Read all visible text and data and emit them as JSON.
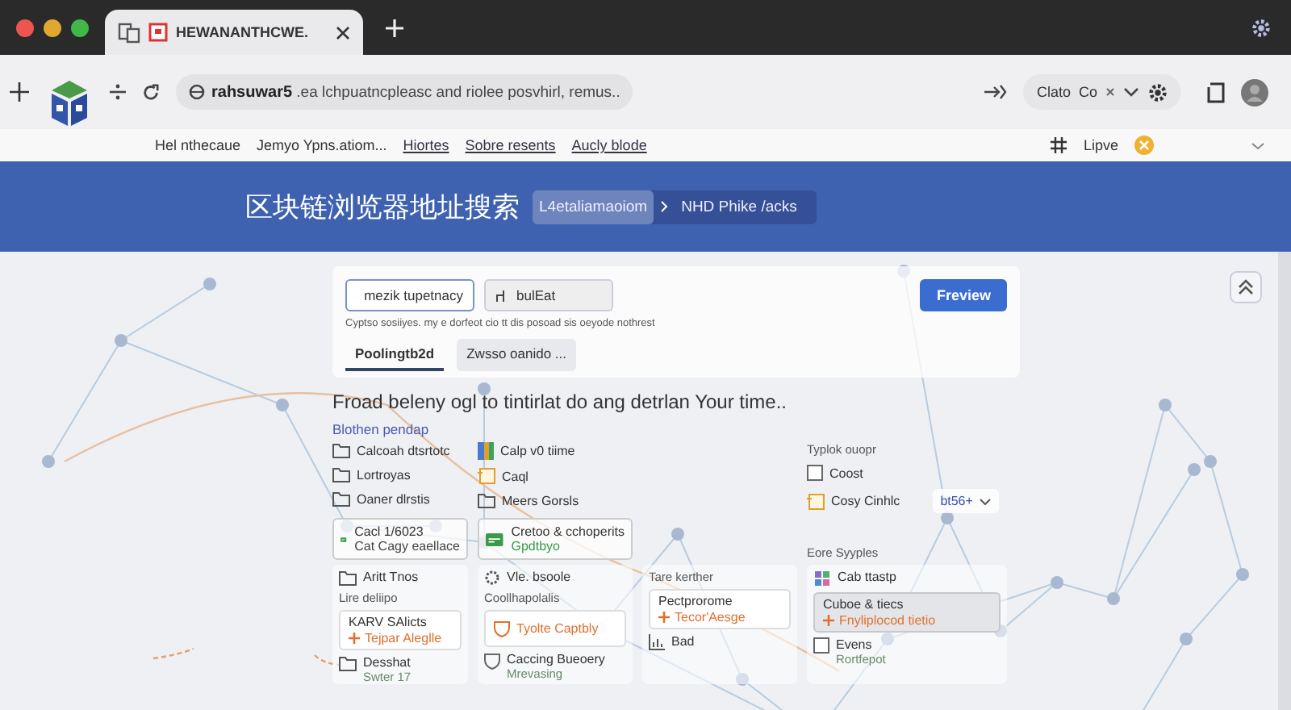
{
  "browser": {
    "tab_title": "HEWANANTHCWE.",
    "url_host": "rahsuwar5",
    "url_rest": " .ea lchpuatncpleasc and riolee posvhirl, remus..",
    "chip_label": "Clato",
    "chip_value": "Co"
  },
  "nav": {
    "links": [
      "Hel nthecaue",
      "Jemyo Ypns.atiom...",
      "Hiortes",
      "Sobre resents",
      "Aucly blode"
    ],
    "live_label": "Lipve"
  },
  "banner": {
    "title": "区块链浏览器地址搜索",
    "breadcrumb": [
      "L4etaliamaoiom",
      "NHD Phike /acks"
    ]
  },
  "search_card": {
    "fields": [
      {
        "value": "mezik tupetnacy",
        "selected": true
      },
      {
        "value": "bulEat",
        "selected": false
      }
    ],
    "button": "Freview",
    "hint": "Cyptso sosiiyes. my e dorfeot cio tt dis posoad sis oeyode nothrest",
    "tabs": [
      {
        "label": "Poolingtb2d",
        "selected": true
      },
      {
        "label": "Zwsso oanido ...",
        "selected": false
      }
    ]
  },
  "heading": "Froad beleny ogl to tintirlat do ang detrlan Your time..",
  "section_link": "Blothen pendap",
  "lists": [
    [
      {
        "kind": "folder",
        "label": "Calcoah dtsrtotc"
      },
      {
        "kind": "folder",
        "label": "Lortroyas"
      },
      {
        "kind": "folder",
        "label": "Oaner dlrstis"
      }
    ],
    [
      {
        "kind": "book",
        "label": "Calp v0 tiime"
      },
      {
        "kind": "note",
        "label": "Caql"
      },
      {
        "kind": "folder",
        "label": "Meers Gorsls"
      }
    ]
  ],
  "options": {
    "title": "Typlok ouopr",
    "items": [
      {
        "kind": "checkbox",
        "label": "Coost",
        "checked": false
      },
      {
        "kind": "note",
        "label": "Cosy Cinhlc"
      }
    ],
    "dropdown": "bt56+"
  },
  "cards": [
    {
      "title": "Cacl 1/6023",
      "subtitle": "Cat Cagy eaellace",
      "color": "#444444"
    },
    {
      "title": "Cretoo & cchoperits",
      "subtitle": "Gpdtbyo",
      "color": "#3a9a4a"
    }
  ],
  "side_label": "Eore Syyples",
  "panels": [
    [
      {
        "kind": "folder",
        "label": "Aritt Tnos"
      },
      {
        "kind": "label",
        "label": "Lire deliipo"
      },
      {
        "kind": "card",
        "label": "KARV SAlicts",
        "note": "Tejpar Aleglle",
        "selected": false
      },
      {
        "kind": "folder",
        "label": "Desshat",
        "detail": "Swter 17"
      }
    ],
    [
      {
        "kind": "gear",
        "label": "Vle. bsoole"
      },
      {
        "kind": "label",
        "label": "Coollhapolalis"
      },
      {
        "kind": "flag",
        "label": "Tyolte Captbly"
      },
      {
        "kind": "shield",
        "label": "Caccing Bueoery",
        "detail": "Mrevasing"
      }
    ],
    [
      {
        "kind": "label",
        "label": "Tare kerther"
      },
      {
        "kind": "card",
        "label": "Pectprorome",
        "note": "Tecor'Aesge",
        "selected": false
      },
      {
        "kind": "chart",
        "label": "Bad"
      }
    ],
    [
      {
        "kind": "puzzle",
        "label": "Cab ttastp"
      },
      {
        "kind": "card",
        "label": "Cuboe & tiecs",
        "note": "Fnyliplocod tietio",
        "selected": true
      },
      {
        "kind": "checkbox",
        "label": "Evens",
        "detail": "Rortfepot",
        "checked": false
      }
    ]
  ]
}
